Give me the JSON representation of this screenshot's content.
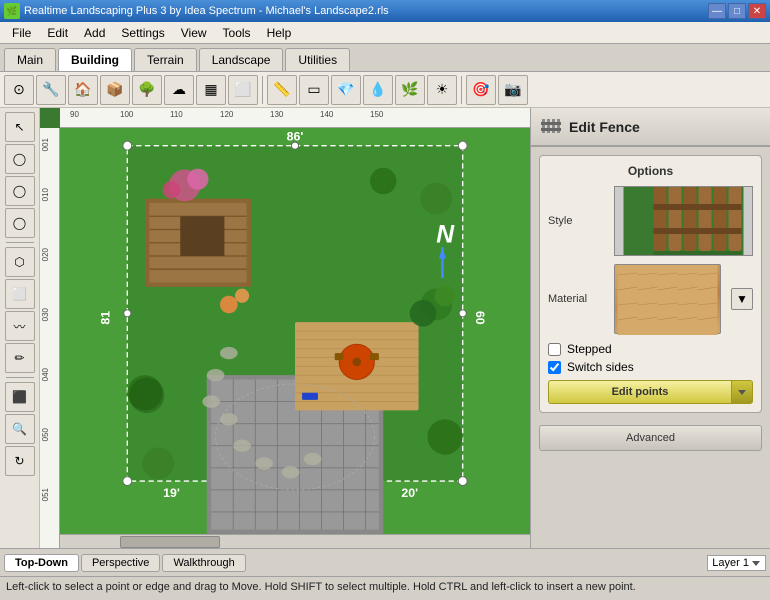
{
  "window": {
    "title": "Realtime Landscaping Plus 3 by Idea Spectrum - Michael's Landscape2.rls",
    "icon": "🌿"
  },
  "titlebar": {
    "minimize": "—",
    "maximize": "□",
    "close": "✕"
  },
  "menubar": {
    "items": [
      "File",
      "Edit",
      "Add",
      "Settings",
      "View",
      "Tools",
      "Help"
    ]
  },
  "tabs": {
    "items": [
      "Main",
      "Building",
      "Terrain",
      "Landscape",
      "Utilities"
    ],
    "active": "Building"
  },
  "toolbar": {
    "tools": [
      "🔍",
      "⚙",
      "🏠",
      "📦",
      "🌲",
      "🔧",
      "⬛",
      "🔲",
      "📐",
      "⬜",
      "🔷",
      "💧",
      "🌿",
      "☀",
      "🎯",
      "📷"
    ]
  },
  "left_tools": [
    "↖",
    "○",
    "○",
    "○",
    "⬡",
    "🔲",
    "〰",
    "✏",
    "⬛",
    "🔍",
    "🔄"
  ],
  "panel": {
    "icon": "|||",
    "title": "Edit Fence",
    "options_label": "Options",
    "style_label": "Style",
    "material_label": "Material",
    "stepped_label": "Stepped",
    "switch_sides_label": "Switch sides",
    "edit_points_label": "Edit points",
    "advanced_label": "Advanced",
    "stepped_checked": false,
    "switch_sides_checked": true
  },
  "ruler": {
    "h_marks": [
      "90",
      "100",
      "110",
      "120",
      "130",
      "140",
      "150"
    ],
    "v_marks": [
      "001",
      "010",
      "020",
      "030",
      "040",
      "050",
      "051"
    ]
  },
  "measurements": {
    "top": "86'",
    "right": "60",
    "bottom_right": "20'",
    "bottom_left": "19'",
    "left": "81"
  },
  "compass": "N",
  "bottom_bar": {
    "views": [
      "Top-Down",
      "Perspective",
      "Walkthrough"
    ],
    "active_view": "Top-Down",
    "layer_label": "Layer 1"
  },
  "statusbar": {
    "text": "Left-click to select a point or edge and drag to Move. Hold SHIFT to select multiple. Hold CTRL and left-click to insert a new point."
  }
}
